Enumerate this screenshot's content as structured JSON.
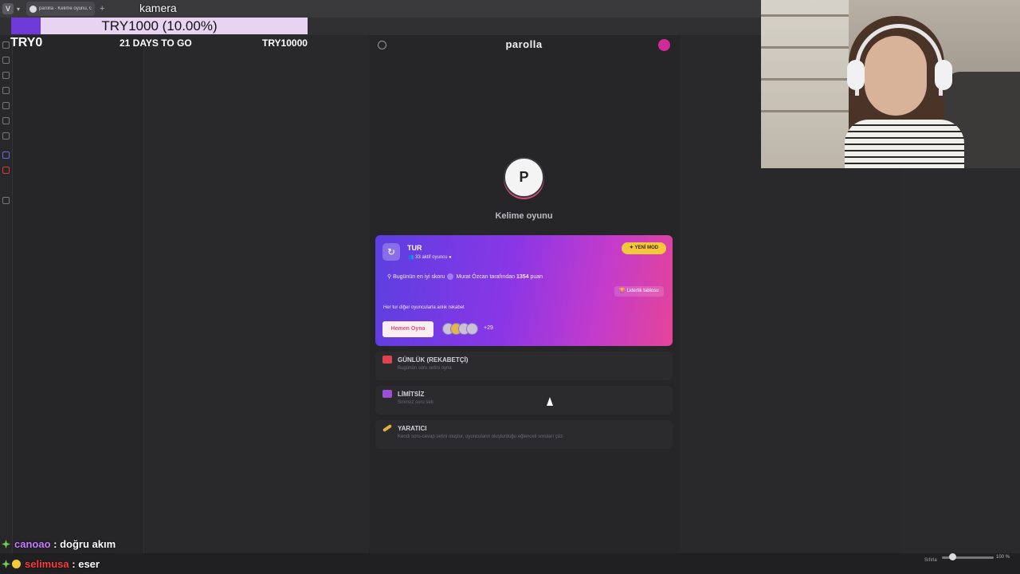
{
  "browser": {
    "tab_title": "parolla - Kelime oyunu, Gü",
    "tab_logo": "V",
    "new_tab": "+",
    "chevron": "▾"
  },
  "overlay": {
    "scene_label": "kamera",
    "goal": {
      "text": "TRY1000 (10.00%)",
      "progress": 0.1,
      "start": "TRY0",
      "days": "21 DAYS TO GO",
      "target": "TRY10000",
      "fill_color": "#6f3bd8",
      "track_color": "#e9d3f2"
    }
  },
  "page": {
    "brand": "parolla",
    "logo_letter": "P",
    "logo_subtitle": "Kelime oyunu",
    "featured": {
      "icon": "↻",
      "title": "TUR",
      "players": "👥 33 aktif oyuncu ●",
      "badge": "✦ YENİ MOD",
      "best_label": "Bugünün en iyi skoru",
      "best_by": "Murat Özcan tarafından",
      "best_score": "1354",
      "best_unit": "puan",
      "leaderboard": "🏆 Liderlik tablosu",
      "description": "Her tur diğer oyuncularla anlık rekabet",
      "play_button": "Hemen Oyna",
      "more_players": "+29"
    },
    "modes": [
      {
        "title": "GÜNLÜK (REKABETÇİ)",
        "desc": "Bugünün soru setini oyna",
        "color": "#e0434f"
      },
      {
        "title": "LİMİTSİZ",
        "desc": "Sınırsız soru seti",
        "color": "#9b4fd6"
      },
      {
        "title": "YARATICI",
        "desc": "Kendi soru-cevap setini oluştur, oyuncuların oluşturduğu eğlenceli soruları çöz",
        "color": "#e0b040"
      }
    ]
  },
  "chat": [
    {
      "user": "canoao",
      "sep": " : ",
      "message": "doğru akım",
      "user_color": "#c77dff",
      "badge_color": "#6fd64a"
    },
    {
      "user": "selimusa",
      "sep": " : ",
      "message": "eser",
      "user_color": "#ff3b3b",
      "badge_color": "#f3c83a"
    }
  ],
  "statusbar": {
    "zoom_label": "Sıfırla",
    "zoom_level": "100 %",
    "zoom_fraction": 0.2
  }
}
